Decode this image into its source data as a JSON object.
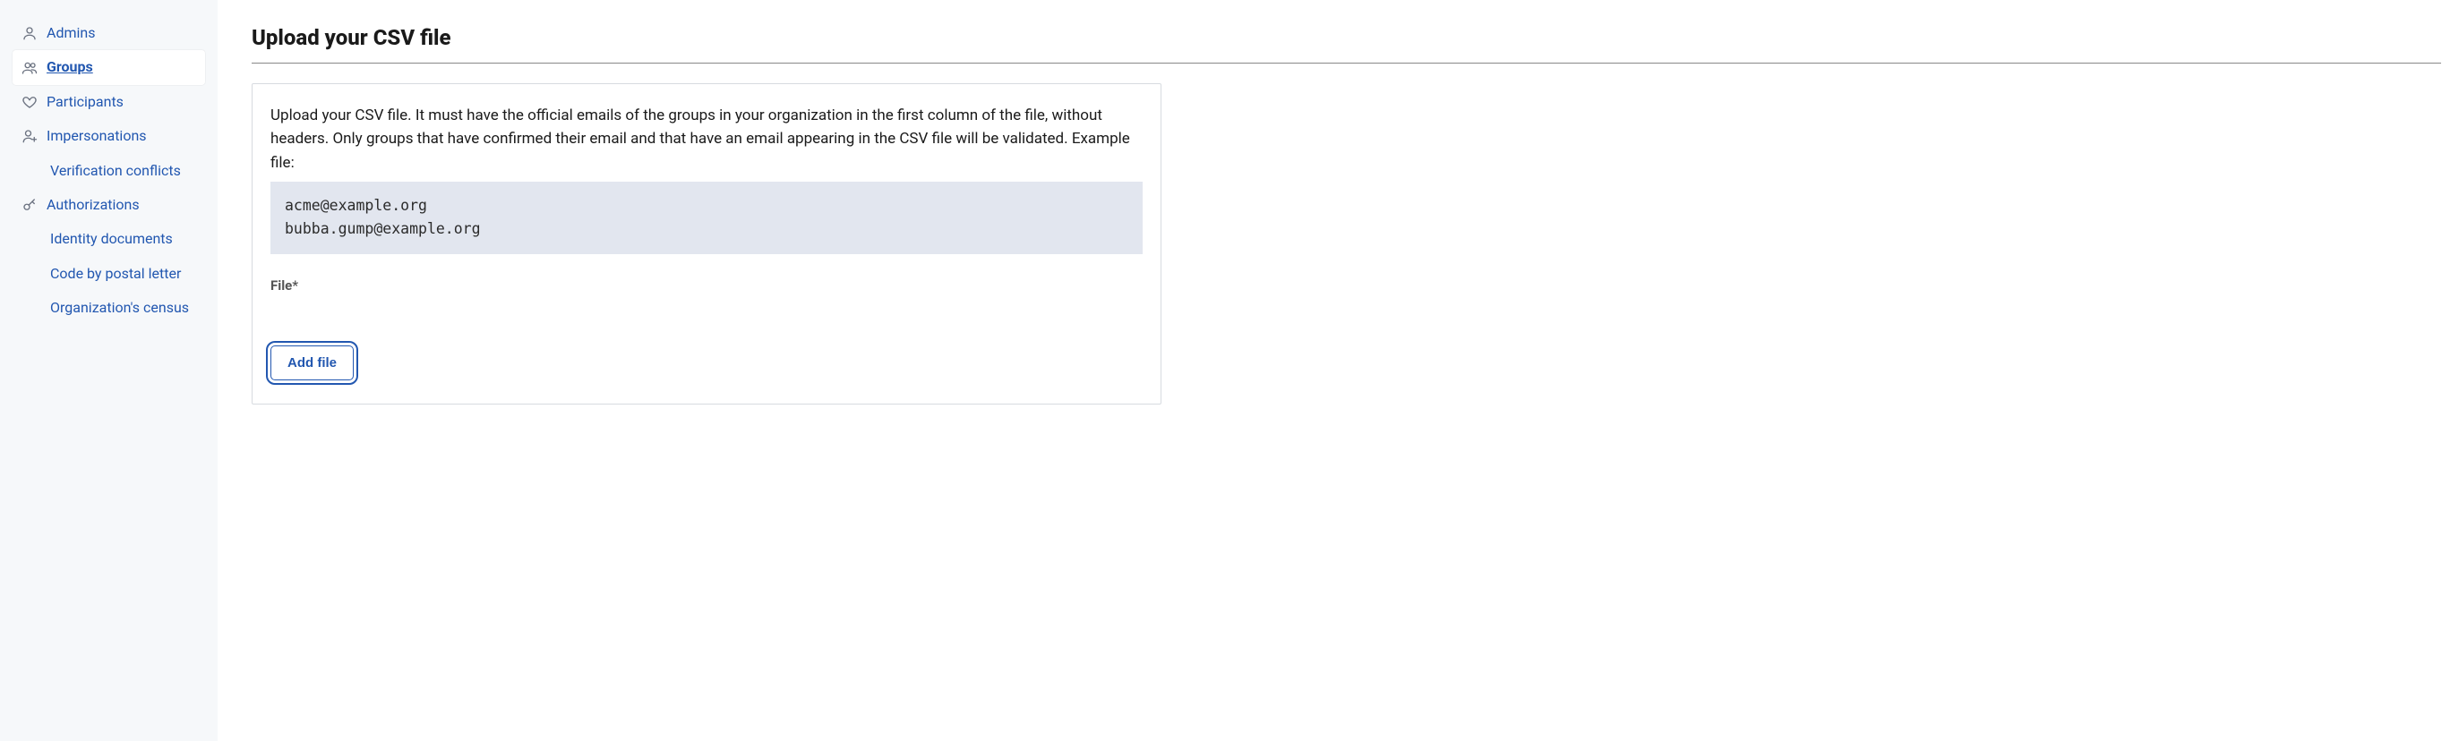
{
  "sidebar": {
    "items": [
      {
        "label": "Admins"
      },
      {
        "label": "Groups"
      },
      {
        "label": "Participants"
      },
      {
        "label": "Impersonations"
      },
      {
        "label": "Verification conflicts"
      },
      {
        "label": "Authorizations"
      },
      {
        "label": "Identity documents"
      },
      {
        "label": "Code by postal letter"
      },
      {
        "label": "Organization's census"
      }
    ]
  },
  "main": {
    "title": "Upload your CSV file",
    "description": "Upload your CSV file. It must have the official emails of the groups in your organization in the first column of the file, without headers. Only groups that have confirmed their email and that have an email appearing in the CSV file will be validated. Example file:",
    "example": "acme@example.org\nbubba.gump@example.org",
    "file_label": "File*",
    "add_file_label": "Add file"
  }
}
